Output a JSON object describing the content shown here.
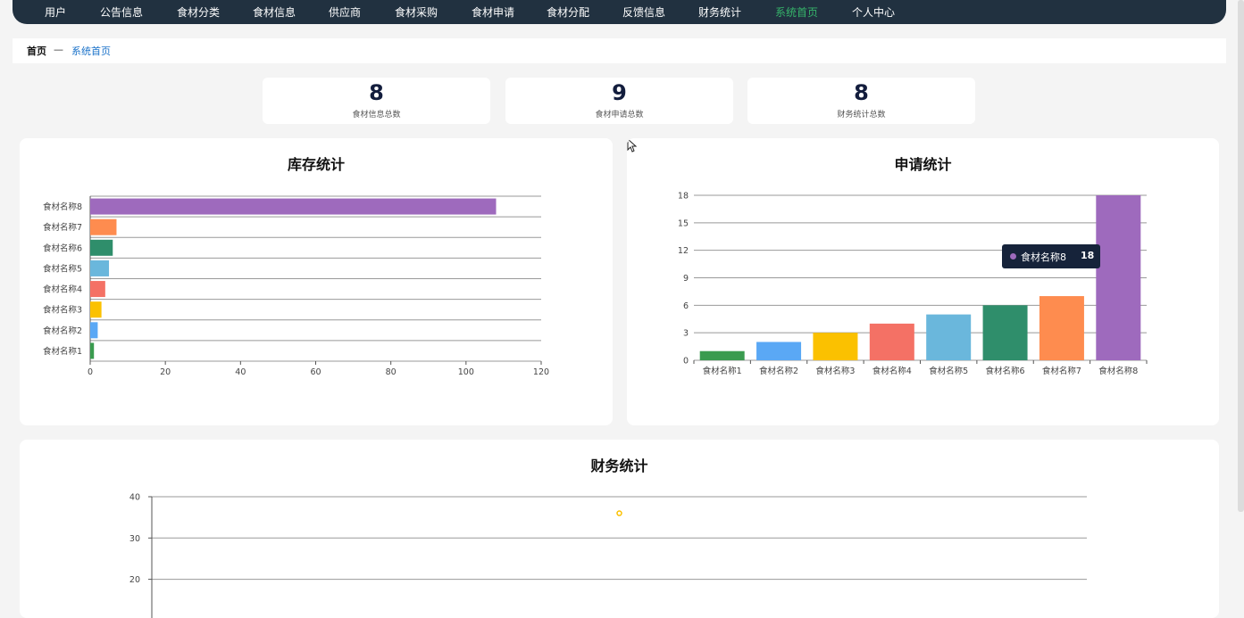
{
  "nav": {
    "items": [
      {
        "label": "用户",
        "name": "users"
      },
      {
        "label": "公告信息",
        "name": "announcements"
      },
      {
        "label": "食材分类",
        "name": "ingredient-category"
      },
      {
        "label": "食材信息",
        "name": "ingredient-info"
      },
      {
        "label": "供应商",
        "name": "supplier"
      },
      {
        "label": "食材采购",
        "name": "ingredient-purchase"
      },
      {
        "label": "食材申请",
        "name": "ingredient-request"
      },
      {
        "label": "食材分配",
        "name": "ingredient-allocation"
      },
      {
        "label": "反馈信息",
        "name": "feedback"
      },
      {
        "label": "财务统计",
        "name": "finance-stats"
      },
      {
        "label": "系统首页",
        "name": "system-home",
        "active": true
      },
      {
        "label": "个人中心",
        "name": "personal-center"
      }
    ],
    "active_color": "#36b36a"
  },
  "breadcrumb": {
    "home": "首页",
    "separator": "—",
    "current": "系统首页"
  },
  "stats": [
    {
      "value": "8",
      "label": "食材信息总数"
    },
    {
      "value": "9",
      "label": "食材申请总数"
    },
    {
      "value": "8",
      "label": "财务统计总数"
    }
  ],
  "cards": {
    "inventory_title": "库存统计",
    "request_title": "申请统计",
    "finance_title": "财务统计"
  },
  "tooltip": {
    "name": "食材名称8",
    "value": "18"
  },
  "chart_data": [
    {
      "type": "bar",
      "orientation": "horizontal",
      "title": "库存统计",
      "categories": [
        "食材名称1",
        "食材名称2",
        "食材名称3",
        "食材名称4",
        "食材名称5",
        "食材名称6",
        "食材名称7",
        "食材名称8"
      ],
      "values": [
        1,
        2,
        3,
        4,
        5,
        6,
        7,
        108
      ],
      "colors": [
        "#3a9b4f",
        "#5aa8f5",
        "#fbc100",
        "#f47165",
        "#6ab7dc",
        "#2f8e6b",
        "#fe8c4f",
        "#9e6abd"
      ],
      "xlim": [
        0,
        120
      ],
      "xticks": [
        0,
        20,
        40,
        60,
        80,
        100,
        120
      ],
      "grid": true
    },
    {
      "type": "bar",
      "title": "申请统计",
      "categories": [
        "食材名称1",
        "食材名称2",
        "食材名称3",
        "食材名称4",
        "食材名称5",
        "食材名称6",
        "食材名称7",
        "食材名称8"
      ],
      "values": [
        1,
        2,
        3,
        4,
        5,
        6,
        7,
        18
      ],
      "colors": [
        "#3a9b4f",
        "#5aa8f5",
        "#fbc100",
        "#f47165",
        "#6ab7dc",
        "#2f8e6b",
        "#fe8c4f",
        "#9e6abd"
      ],
      "ylim": [
        0,
        18
      ],
      "yticks": [
        0,
        3,
        6,
        9,
        12,
        15,
        18
      ],
      "grid": true
    },
    {
      "type": "scatter",
      "title": "财务统计",
      "yticks_visible": [
        20,
        30,
        40
      ],
      "points": [
        {
          "y": 36,
          "color": "#fbc100"
        }
      ],
      "grid": true
    }
  ]
}
